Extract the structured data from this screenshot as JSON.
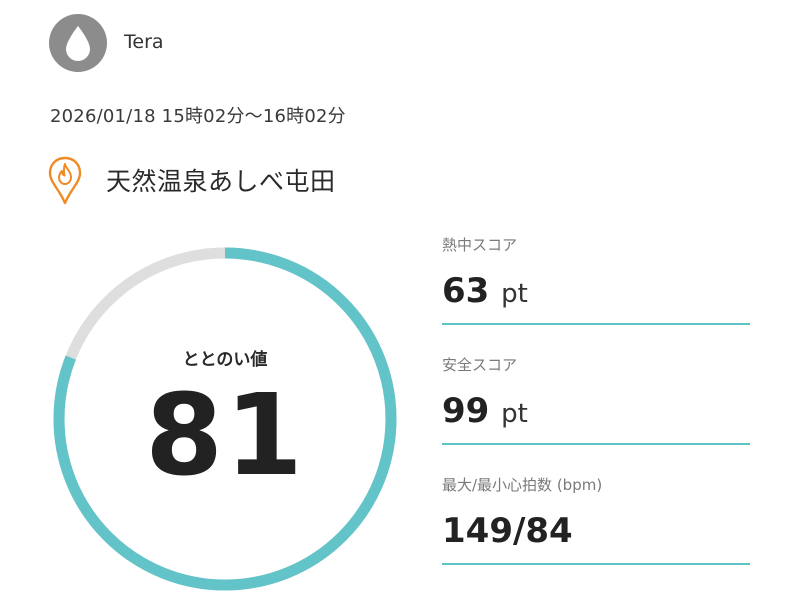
{
  "user": {
    "name": "Tera",
    "avatar_icon": "water-drop-icon"
  },
  "session": {
    "datetime": "2026/01/18 15時02分〜16時02分"
  },
  "facility": {
    "icon": "flame-pin-icon",
    "name": "天然温泉あしべ屯田"
  },
  "totonoi": {
    "label": "ととのい値",
    "value": "81",
    "progress": 0.81,
    "ring_color": "#62c3c9",
    "track_color": "#dedede"
  },
  "metrics": [
    {
      "label": "熱中スコア",
      "value": "63",
      "unit": "pt"
    },
    {
      "label": "安全スコア",
      "value": "99",
      "unit": "pt"
    },
    {
      "label": "最大/最小心拍数 (bpm)",
      "value": "149/84",
      "unit": ""
    }
  ],
  "colors": {
    "accent": "#62c3c9",
    "facility_icon": "#f08a24",
    "avatar_bg": "#8c8c8c"
  }
}
